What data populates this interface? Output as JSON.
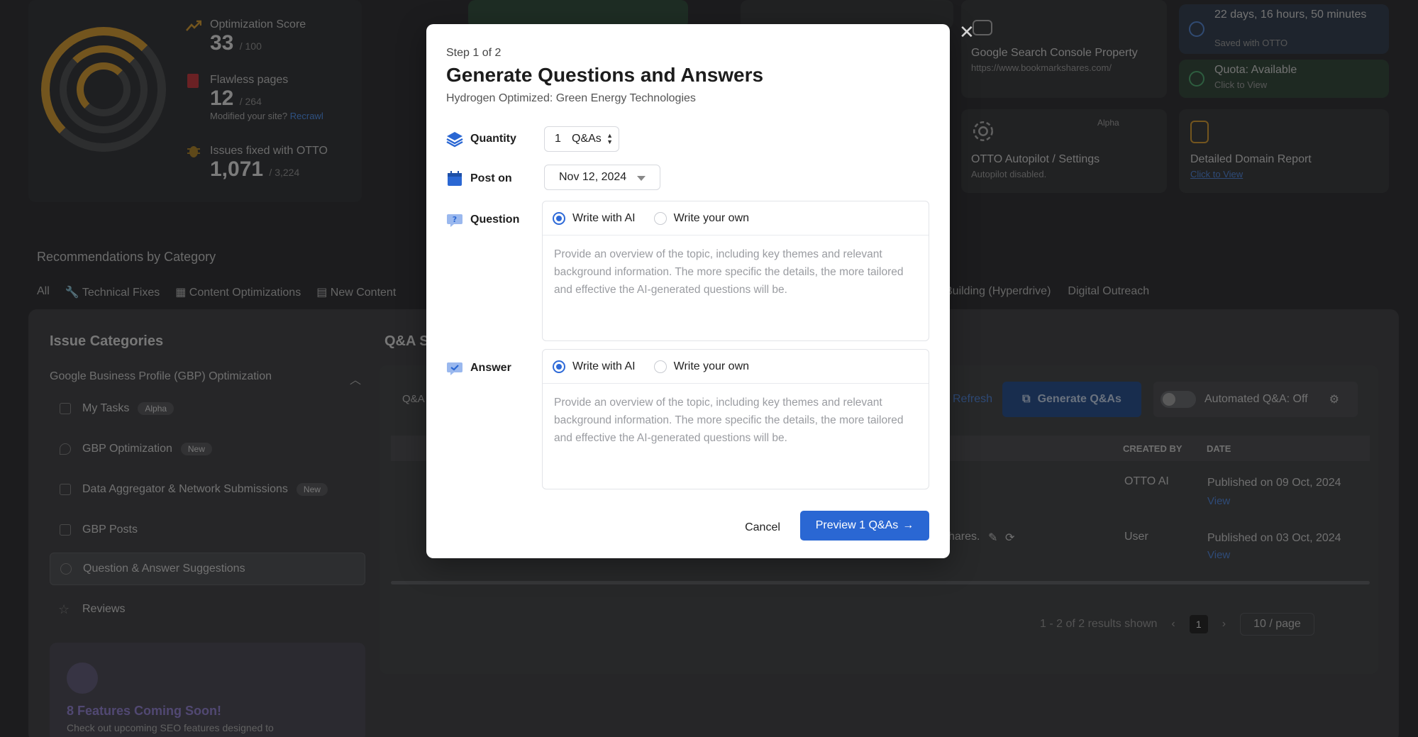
{
  "dashboard": {
    "score": {
      "label": "Optimization Score",
      "value": "33",
      "total": "/ 100"
    },
    "flawless": {
      "label": "Flawless pages",
      "value": "12",
      "total": "/ 264",
      "sub": "Modified your site?",
      "recrawl": "Recrawl"
    },
    "issues_fixed": {
      "label": "Issues fixed with OTTO",
      "value": "1,071",
      "total": "/ 3,224"
    },
    "tiles": {
      "gsc_title": "Google Search Console Property",
      "gsc_url": "https://www.bookmarkshares.com/",
      "time_title": "22 days, 16 hours, 50 minutes",
      "time_sub": "Saved with OTTO",
      "quota_title": "Quota: Available",
      "quota_sub": "Click to View",
      "autopilot_badge": "Alpha",
      "autopilot_title": "OTTO Autopilot / Settings",
      "autopilot_sub": "Autopilot disabled.",
      "domain_title": "Detailed Domain Report",
      "domain_sub": "Click to View"
    },
    "recommendations_title": "Recommendations by Category",
    "category_tabs": [
      "All",
      "Technical Fixes",
      "Content Optimizations",
      "New Content"
    ],
    "category_tabs_right": [
      "Building (Hyperdrive)",
      "Digital Outreach"
    ],
    "issue_categories": {
      "title": "Issue Categories",
      "group": "Google Business Profile (GBP) Optimization",
      "items": [
        {
          "label": "My Tasks",
          "badge": "Alpha"
        },
        {
          "label": "GBP Optimization",
          "badge": "New"
        },
        {
          "label": "Data Aggregator & Network Submissions",
          "badge": "New"
        },
        {
          "label": "GBP Posts",
          "badge": ""
        },
        {
          "label": "Question & Answer Suggestions",
          "badge": ""
        },
        {
          "label": "Reviews",
          "badge": ""
        }
      ]
    },
    "coming_soon": {
      "title": "8 Features Coming Soon!",
      "sub": "Check out upcoming SEO features designed to"
    },
    "qa": {
      "title": "Q&A S",
      "left_label": "Q&A",
      "refresh": "Refresh",
      "generate": "Generate Q&As",
      "automated": "Automated Q&A: Off",
      "columns": {
        "created_by": "CREATED BY",
        "date": "DATE"
      },
      "rows": [
        {
          "snippet": "",
          "created_by": "OTTO AI",
          "date": "Published on 09 Oct, 2024",
          "link": "View"
        },
        {
          "snippet": "hares.",
          "created_by": "User",
          "date": "Published on 03 Oct, 2024",
          "link": "View"
        }
      ],
      "pager": {
        "summary": "1 - 2 of 2 results shown",
        "page": "1",
        "size": "10 / page"
      }
    }
  },
  "modal": {
    "step": "Step 1 of 2",
    "title": "Generate Questions and Answers",
    "subtitle": "Hydrogen Optimized: Green Energy Technologies",
    "quantity": {
      "label": "Quantity",
      "value": "1",
      "unit": "Q&As"
    },
    "post_on": {
      "label": "Post on",
      "value": "Nov 12, 2024"
    },
    "question": {
      "label": "Question",
      "option_ai": "Write with AI",
      "option_own": "Write your own",
      "placeholder": "Provide an overview of the topic, including key themes and relevant background information. The more specific the details, the more tailored and effective the AI-generated questions will be."
    },
    "answer": {
      "label": "Answer",
      "option_ai": "Write with AI",
      "option_own": "Write your own",
      "placeholder": "Provide an overview of the topic, including key themes and relevant background information. The more specific the details, the more tailored and effective the AI-generated questions will be."
    },
    "cancel": "Cancel",
    "preview": "Preview 1 Q&As"
  },
  "colors": {
    "primary": "#2a67d3",
    "brand_gold": "#c9922e"
  }
}
